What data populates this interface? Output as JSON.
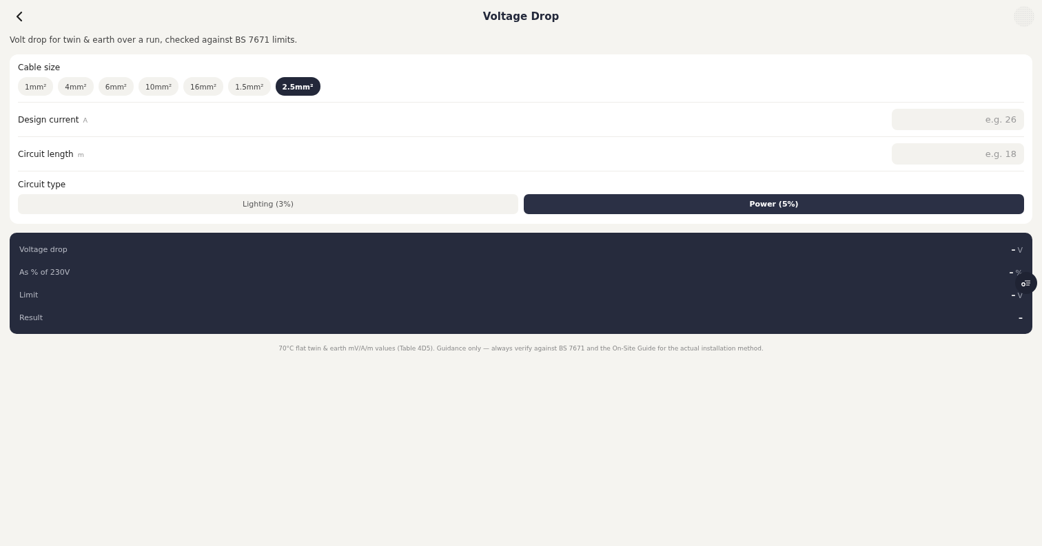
{
  "header": {
    "title": "Voltage Drop"
  },
  "description": "Volt drop for twin & earth over a run, checked against BS 7671 limits.",
  "cable_size": {
    "label": "Cable size",
    "options": [
      {
        "label": "1mm²",
        "selected": false
      },
      {
        "label": "4mm²",
        "selected": false
      },
      {
        "label": "6mm²",
        "selected": false
      },
      {
        "label": "10mm²",
        "selected": false
      },
      {
        "label": "16mm²",
        "selected": false
      },
      {
        "label": "1.5mm²",
        "selected": false
      },
      {
        "label": "2.5mm²",
        "selected": true
      }
    ]
  },
  "fields": [
    {
      "label": "Design current",
      "unit": "A",
      "placeholder": "e.g. 26"
    },
    {
      "label": "Circuit length",
      "unit": "m",
      "placeholder": "e.g. 18"
    }
  ],
  "circuit_type": {
    "label": "Circuit type",
    "options": [
      {
        "label": "Lighting (3%)",
        "selected": false
      },
      {
        "label": "Power (5%)",
        "selected": true
      }
    ]
  },
  "results": [
    {
      "label": "Voltage drop",
      "value": "–",
      "unit": "V"
    },
    {
      "label": "As % of 230V",
      "value": "–",
      "unit": "%"
    },
    {
      "label": "Limit",
      "value": "–",
      "unit": "V"
    },
    {
      "label": "Result",
      "value": "–"
    }
  ],
  "footnote": "70°C flat twin & earth mV/A/m values (Table 4D5). Guidance only — always verify against BS 7671 and the On-Site Guide for the actual installation method."
}
